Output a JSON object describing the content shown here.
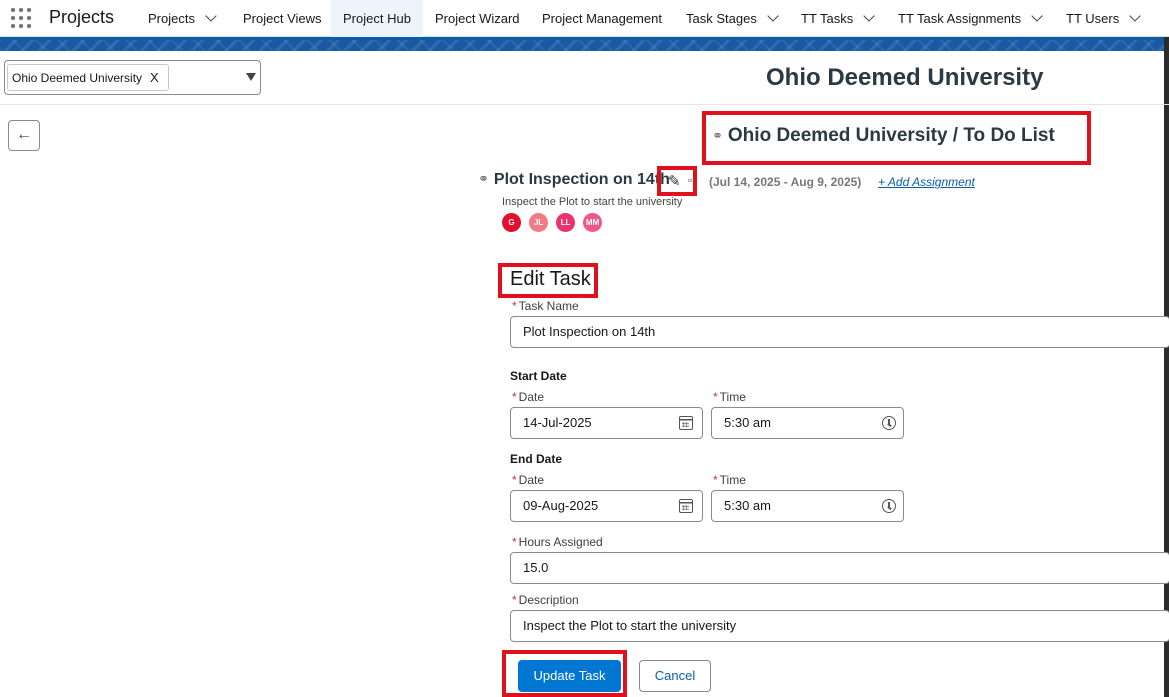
{
  "nav": {
    "app_name": "Projects",
    "items": [
      {
        "label": "Projects",
        "has_menu": true
      },
      {
        "label": "Project Views",
        "has_menu": false
      },
      {
        "label": "Project Hub",
        "has_menu": false,
        "active": true
      },
      {
        "label": "Project Wizard",
        "has_menu": false
      },
      {
        "label": "Project Management",
        "has_menu": false
      },
      {
        "label": "Task Stages",
        "has_menu": true
      },
      {
        "label": "TT Tasks",
        "has_menu": true
      },
      {
        "label": "TT Task Assignments",
        "has_menu": true
      },
      {
        "label": "TT Users",
        "has_menu": true
      }
    ]
  },
  "project_select": {
    "selected": "Ohio Deemed University",
    "remove_label": "X"
  },
  "page": {
    "title": "Ohio Deemed University",
    "list_title": "Ohio Deemed University / To Do List",
    "back_icon": "arrow-left-icon"
  },
  "task": {
    "name": "Plot Inspection on 14th",
    "dates": "(Jul 14, 2025 - Aug 9, 2025)",
    "add_assignment": "+ Add Assignment",
    "description": "Inspect the Plot to start the university",
    "assignees": [
      {
        "initials": "G",
        "color": "#e3102b"
      },
      {
        "initials": "JL",
        "color": "#f27b83"
      },
      {
        "initials": "LL",
        "color": "#e8336b"
      },
      {
        "initials": "MM",
        "color": "#f0568a"
      }
    ]
  },
  "form": {
    "heading": "Edit Task",
    "required_mark": "*",
    "task_name_label": "Task Name",
    "task_name_value": "Plot Inspection on 14th",
    "start_section": "Start Date",
    "end_section": "End Date",
    "date_label": "Date",
    "time_label": "Time",
    "start_date": "14-Jul-2025",
    "start_time": "5:30 am",
    "end_date": "09-Aug-2025",
    "end_time": "5:30 am",
    "hours_label": "Hours Assigned",
    "hours_value": "15.0",
    "description_label": "Description",
    "description_value": "Inspect the Plot to start the university",
    "update_label": "Update Task",
    "cancel_label": "Cancel"
  },
  "colors": {
    "highlight": "#e1101e",
    "brand_blue": "#0176d3",
    "title_color": "#2b3a42"
  }
}
